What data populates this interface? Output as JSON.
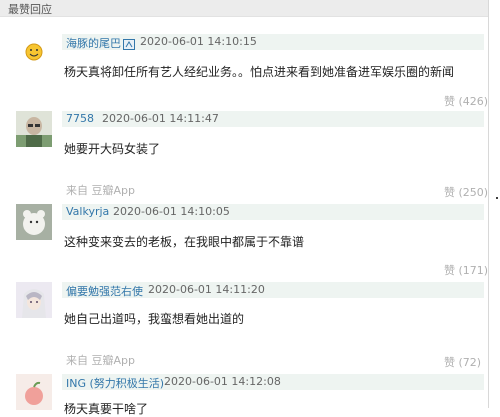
{
  "section_title": "最赞回应",
  "comments": [
    {
      "username": "海豚的尾巴",
      "timestamp": "2020-06-01 14:10:15",
      "text": "杨天真将卸任所有艺人经纪业务。。怕点进来看到她准备进军娱乐圈的新闻",
      "source": "",
      "likes": "赞 (426)"
    },
    {
      "username": "7758",
      "timestamp": "2020-06-01 14:11:47",
      "text": "她要开大码女装了",
      "source": "来自 豆瓣App",
      "likes": "赞 (250)"
    },
    {
      "username": "Valkyrja",
      "timestamp": "2020-06-01 14:10:05",
      "text": "这种变来变去的老板，在我眼中都属于不靠谱",
      "source": "",
      "likes": "赞 (171)"
    },
    {
      "username": "偏要勉强范右使",
      "timestamp": "2020-06-01 14:11:20",
      "text": "她自己出道吗，我蛮想看她出道的",
      "source": "来自 豆瓣App",
      "likes": "赞 (72)"
    },
    {
      "username": "ING (努力积极生活)",
      "timestamp": "2020-06-01 14:12:08",
      "text": "杨天真要干啥了",
      "source": "",
      "likes": ""
    }
  ],
  "colors": {
    "username": "#3377aa",
    "meta_background": "#eef4f1",
    "muted": "#b0b0b0"
  }
}
